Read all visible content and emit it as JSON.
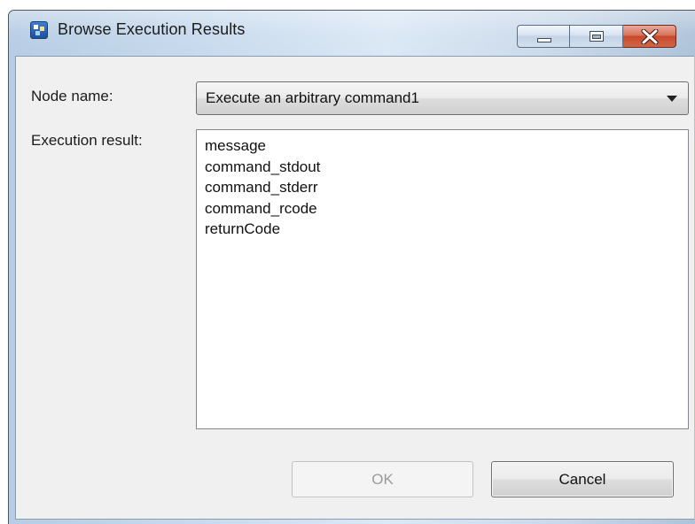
{
  "window": {
    "title": "Browse Execution Results",
    "app_icon": "app-icon",
    "caption_buttons": [
      "minimize-icon",
      "maximize-icon",
      "close-icon"
    ]
  },
  "form": {
    "node_name_label": "Node name:",
    "node_name_value": "Execute an arbitrary command1",
    "execution_result_label": "Execution result:",
    "execution_result_items": [
      "message",
      "command_stdout",
      "command_stderr",
      "command_rcode",
      "returnCode"
    ]
  },
  "buttons": {
    "ok_label": "OK",
    "ok_enabled": false,
    "cancel_label": "Cancel"
  },
  "colors": {
    "close_button": "#c7482c",
    "title_gradient": "#c9dbee",
    "client_background": "#f0f0f0",
    "disabled_text": "#9a9a9a"
  }
}
